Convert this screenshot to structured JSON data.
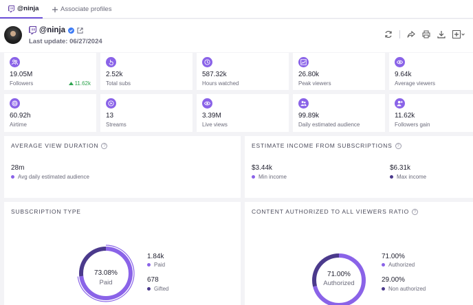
{
  "tabs": {
    "active": "@ninja",
    "associate": "Associate profiles"
  },
  "profile": {
    "name": "@ninja",
    "last_update": "Last update: 06/27/2024"
  },
  "stats_row1": [
    {
      "icon": "followers-icon",
      "value": "19.05M",
      "label": "Followers",
      "delta": "11.62k"
    },
    {
      "icon": "total-subs-icon",
      "value": "2.52k",
      "label": "Total subs"
    },
    {
      "icon": "hours-watched-icon",
      "value": "587.32k",
      "label": "Hours watched"
    },
    {
      "icon": "peak-viewers-icon",
      "value": "26.80k",
      "label": "Peak viewers"
    },
    {
      "icon": "average-viewers-icon",
      "value": "9.64k",
      "label": "Average viewers"
    }
  ],
  "stats_row2": [
    {
      "icon": "airtime-icon",
      "value": "60.92h",
      "label": "Airtime"
    },
    {
      "icon": "streams-icon",
      "value": "13",
      "label": "Streams"
    },
    {
      "icon": "live-views-icon",
      "value": "3.39M",
      "label": "Live views"
    },
    {
      "icon": "daily-audience-icon",
      "value": "99.89k",
      "label": "Daily estimated audience"
    },
    {
      "icon": "followers-gain-icon",
      "value": "11.62k",
      "label": "Followers gain"
    }
  ],
  "avg_view_duration": {
    "title": "AVERAGE VIEW DURATION",
    "value": "28m",
    "label": "Avg daily estimated audience"
  },
  "income": {
    "title": "ESTIMATE INCOME FROM SUBSCRIPTIONS",
    "min_value": "$3.44k",
    "min_label": "Min income",
    "max_value": "$6.31k",
    "max_label": "Max income"
  },
  "subscription_type": {
    "title": "SUBSCRIPTION TYPE",
    "center_pct": "73.08%",
    "center_label": "Paid",
    "paid_fraction": 0.7308,
    "paid_value": "1.84k",
    "paid_label": "Paid",
    "gifted_value": "678",
    "gifted_label": "Gifted"
  },
  "content_ratio": {
    "title": "CONTENT AUTHORIZED TO ALL VIEWERS RATIO",
    "center_pct": "71.00%",
    "center_label": "Authorized",
    "authorized_fraction": 0.71,
    "authorized_value": "71.00%",
    "authorized_label": "Authorized",
    "non_value": "29.00%",
    "non_label": "Non authorized"
  },
  "colors": {
    "accent": "#8a63e8",
    "dark_accent": "#4b3a8c",
    "positive": "#2ea44f",
    "twitch": "#6441a5",
    "verified": "#3d7bf5"
  }
}
